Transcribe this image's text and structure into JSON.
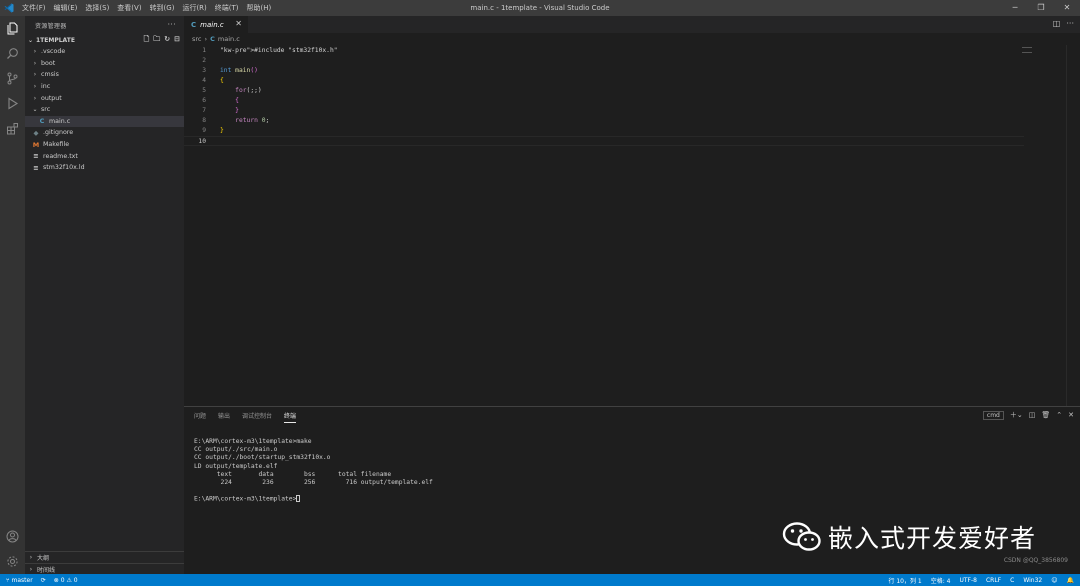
{
  "window": {
    "title": "main.c - 1template - Visual Studio Code",
    "menu": [
      "文件(F)",
      "编辑(E)",
      "选择(S)",
      "查看(V)",
      "转到(G)",
      "运行(R)",
      "终端(T)",
      "帮助(H)"
    ],
    "controls": [
      "─",
      "❐",
      "✕"
    ]
  },
  "activity_bar": {
    "icons": [
      "explorer-icon",
      "search-icon",
      "source-control-icon",
      "run-debug-icon",
      "extensions-icon",
      "account-icon",
      "settings-gear-icon"
    ]
  },
  "sidebar": {
    "header": "资源管理器",
    "more": "···",
    "project": "1TEMPLATE",
    "tree": [
      {
        "label": ".vscode",
        "kind": "folder",
        "expanded": false,
        "depth": 1
      },
      {
        "label": "boot",
        "kind": "folder",
        "expanded": false,
        "depth": 1
      },
      {
        "label": "cmsis",
        "kind": "folder",
        "expanded": false,
        "depth": 1
      },
      {
        "label": "inc",
        "kind": "folder",
        "expanded": false,
        "depth": 1
      },
      {
        "label": "output",
        "kind": "folder",
        "expanded": false,
        "depth": 1
      },
      {
        "label": "src",
        "kind": "folder",
        "expanded": true,
        "depth": 1
      },
      {
        "label": "main.c",
        "kind": "c",
        "icon": "C",
        "selected": true,
        "depth": 2
      },
      {
        "label": ".gitignore",
        "kind": "git",
        "icon": "◆",
        "depth": 1
      },
      {
        "label": "Makefile",
        "kind": "make",
        "icon": "M",
        "depth": 1
      },
      {
        "label": "readme.txt",
        "kind": "txt",
        "icon": "≡",
        "depth": 1
      },
      {
        "label": "stm32f10x.ld",
        "kind": "ld",
        "icon": "≡",
        "depth": 1
      }
    ],
    "outline": "大纲",
    "timeline": "时间线"
  },
  "editor": {
    "tab_label": "main.c",
    "tab_icon": "C",
    "tab_close": "✕",
    "breadcrumb": [
      "src",
      "main.c"
    ],
    "lines": [
      "#include \"stm32f10x.h\"",
      "",
      "int main()",
      "{",
      "    for(;;)",
      "    {",
      "    }",
      "    return 0;",
      "}",
      ""
    ]
  },
  "panel": {
    "tabs": [
      "问题",
      "输出",
      "调试控制台",
      "终端"
    ],
    "active_tab": "终端",
    "shell": "cmd",
    "terminal_lines": [
      "E:\\ARM\\cortex-m3\\1template>make",
      "CC output/./src/main.o",
      "CC output/./boot/startup_stm32f10x.o",
      "LD output/template.elf",
      "      text       data        bss      total filename",
      "       224        236        256        716 output/template.elf",
      "",
      "E:\\ARM\\cortex-m3\\1template>"
    ]
  },
  "statusbar": {
    "branch": "master",
    "errors": "0",
    "warnings": "0",
    "position": "行 10，列 1",
    "spaces": "空格: 4",
    "encoding": "UTF-8",
    "eol": "CRLF",
    "language": "C",
    "platform": "Win32"
  },
  "watermark": {
    "text": "嵌入式开发爱好者",
    "credit": "CSDN @QQ_3856809"
  }
}
